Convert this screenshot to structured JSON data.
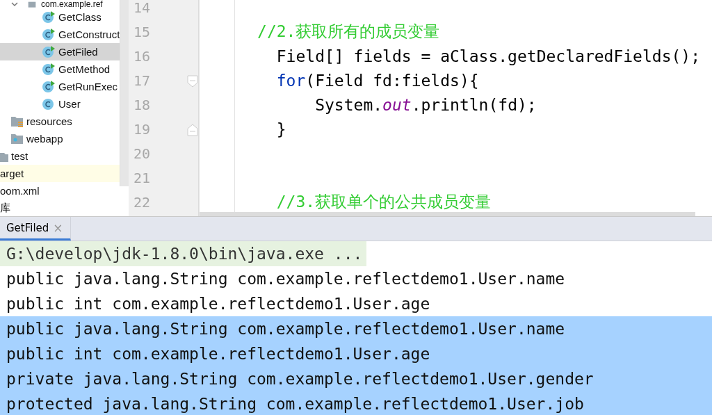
{
  "project_tree": [
    {
      "children": [
        {
          "children": [
            {
              "children": [
                {
                  "label": "com.example.ref",
                  "kind": "package",
                  "expanded": true,
                  "selected": false,
                  "children": [
                    {
                      "label": "GetClass",
                      "kind": "class",
                      "runnable": true,
                      "selected": false
                    },
                    {
                      "label": "GetConstruct",
                      "kind": "class",
                      "runnable": true,
                      "selected": false
                    },
                    {
                      "label": "GetFiled",
                      "kind": "class",
                      "runnable": true,
                      "selected": true
                    },
                    {
                      "label": "GetMethod",
                      "kind": "class",
                      "runnable": true,
                      "selected": false
                    },
                    {
                      "label": "GetRunExec",
                      "kind": "class",
                      "runnable": true,
                      "selected": false
                    },
                    {
                      "label": "User",
                      "kind": "class",
                      "runnable": false,
                      "selected": false
                    }
                  ]
                }
              ]
            },
            {
              "label": "resources",
              "kind": "resources-folder",
              "selected": false
            },
            {
              "label": "webapp",
              "kind": "web-folder",
              "selected": false
            }
          ]
        },
        {
          "label": "test",
          "kind": "folder",
          "selected": false
        }
      ]
    },
    {
      "label": "arget",
      "kind": "excluded-folder",
      "selected": false
    },
    {
      "label": "oom.xml",
      "kind": "file",
      "selected": false
    },
    {
      "label": "库",
      "kind": "library",
      "selected": false
    }
  ],
  "editor": {
    "lines": [
      {
        "number": "14",
        "fold_start": false,
        "fold_end": false
      },
      {
        "number": "15",
        "fold_start": false,
        "fold_end": false,
        "segments": [
          {
            "kind": "comment",
            "text": "      //2.获取所有的成员变量"
          }
        ]
      },
      {
        "number": "16",
        "fold_start": false,
        "fold_end": false,
        "segments": [
          {
            "kind": "plain",
            "text": "        Field[] fields = aClass.getDeclaredFields();"
          }
        ]
      },
      {
        "number": "17",
        "fold_start": true,
        "fold_end": false,
        "segments": [
          {
            "kind": "keyword",
            "text": "        for"
          },
          {
            "kind": "plain",
            "text": "(Field fd:fields){"
          }
        ]
      },
      {
        "number": "18",
        "fold_start": false,
        "fold_end": false,
        "segments": [
          {
            "kind": "plain",
            "text": "            System."
          },
          {
            "kind": "static-field",
            "text": "out"
          },
          {
            "kind": "plain",
            "text": ".println(fd);"
          }
        ]
      },
      {
        "number": "19",
        "fold_start": false,
        "fold_end": true,
        "segments": [
          {
            "kind": "plain",
            "text": "        }"
          }
        ]
      },
      {
        "number": "20",
        "fold_start": false,
        "fold_end": false
      },
      {
        "number": "21",
        "fold_start": false,
        "fold_end": false
      },
      {
        "number": "22",
        "fold_start": false,
        "fold_end": false,
        "segments": [
          {
            "kind": "comment",
            "text": "        //3.获取单个的公共成员变量"
          }
        ]
      }
    ]
  },
  "run_panel": {
    "tab": {
      "label": "GetFiled",
      "close": "×",
      "selected": true
    },
    "lines": [
      {
        "kind": "command",
        "text": "G:\\develop\\jdk-1.8.0\\bin\\java.exe ...",
        "selected": false
      },
      {
        "kind": "output",
        "text": "public java.lang.String com.example.reflectdemo1.User.name",
        "selected": false
      },
      {
        "kind": "output",
        "text": "public int com.example.reflectdemo1.User.age",
        "selected": false
      },
      {
        "kind": "output",
        "text": "public java.lang.String com.example.reflectdemo1.User.name",
        "selected": true
      },
      {
        "kind": "output",
        "text": "public int com.example.reflectdemo1.User.age",
        "selected": true
      },
      {
        "kind": "output",
        "text": "private java.lang.String com.example.reflectdemo1.User.gender",
        "selected": true
      },
      {
        "kind": "output",
        "text": "protected java.lang.String com.example.reflectdemo1.User.job",
        "selected": true
      }
    ]
  }
}
